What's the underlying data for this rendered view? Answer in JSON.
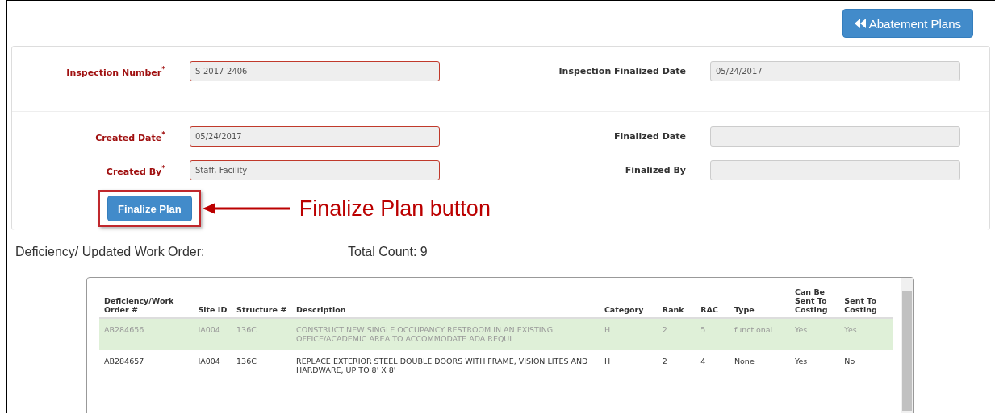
{
  "back_button": {
    "label": "Abatement Plans"
  },
  "form": {
    "sections": [
      {
        "rows": [
          {
            "left": {
              "label": "Inspection Number$^{*}$",
              "required": true,
              "value": "S-2017-2406"
            },
            "right": {
              "label": "Inspection Finalized Date",
              "required": false,
              "value": "05/24/2017"
            }
          }
        ]
      },
      {
        "rows": [
          {
            "left": {
              "label": "Created Date$^{*}$",
              "required": true,
              "value": "05/24/2017"
            },
            "right": {
              "label": "Finalized Date",
              "required": false
            }
          },
          {
            "left": {
              "label": "Created By$^{*}$",
              "required": true,
              "value": "Staff, Facility"
            },
            "right": {
              "label": "Finalized By",
              "required": false
            }
          }
        ]
      }
    ]
  },
  "finalize_button": {
    "label": "Finalize Plan"
  },
  "annotation": {
    "text": "Finalize Plan button"
  },
  "list_title": "Deficiency/ Updated Work Order:",
  "total_count": "Total Count: 9",
  "table": {
    "columns": [
      "Deficiency/Work Order #",
      "Site ID",
      "Structure #",
      "Description",
      "Category",
      "Rank",
      "RAC",
      "Type",
      "Can Be Sent To Costing",
      "Sent To Costing"
    ],
    "rows": [
      {
        "selected": true,
        "cells": [
          "AB284656",
          "IA004",
          "136C",
          "CONSTRUCT NEW SINGLE OCCUPANCY RESTROOM IN AN EXISTING OFFICE/ACADEMIC AREA TO ACCOMMODATE ADA REQUI",
          "H",
          "2",
          "5",
          "functional",
          "Yes",
          "Yes"
        ]
      },
      {
        "selected": false,
        "cells": [
          "AB284657",
          "IA004",
          "136C",
          "REPLACE EXTERIOR STEEL DOUBLE DOORS WITH FRAME, VISION LITES AND HARDWARE, UP TO 8' X 8'",
          "H",
          "2",
          "4",
          "None",
          "Yes",
          "No"
        ]
      }
    ]
  }
}
